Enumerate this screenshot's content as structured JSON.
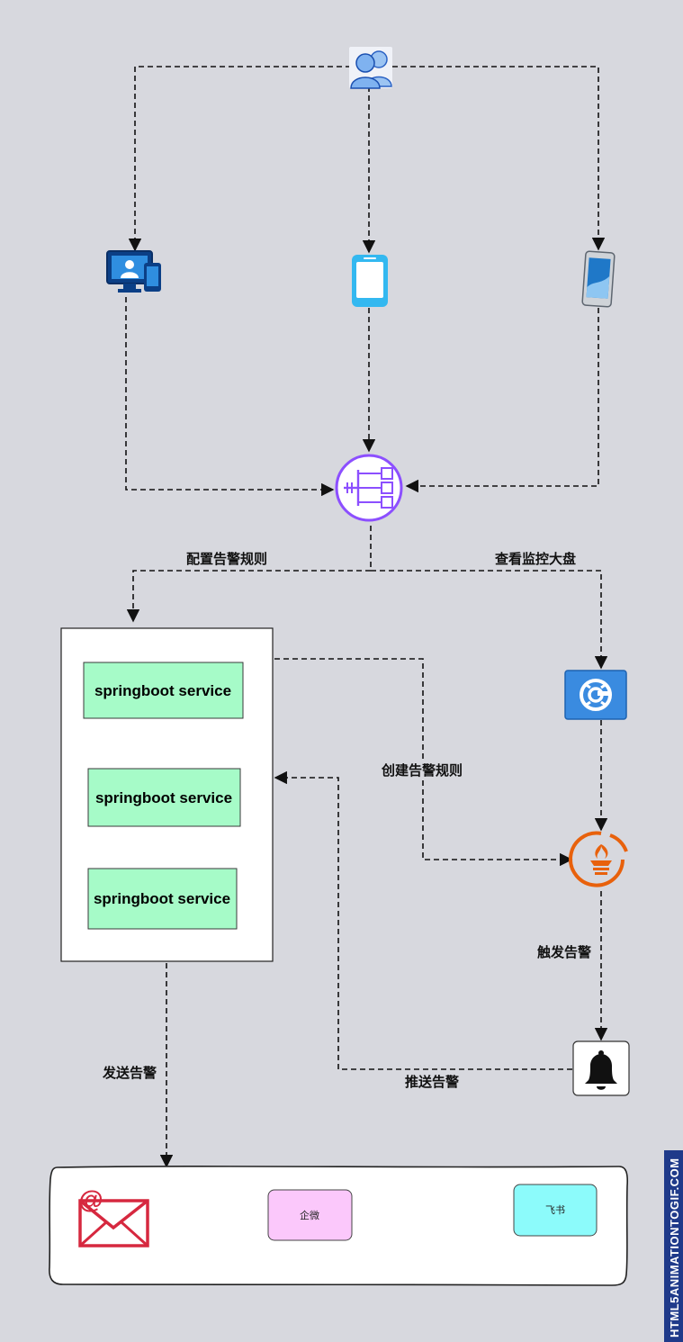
{
  "labels": {
    "config_rules": "配置告警规则",
    "view_dashboard": "查看监控大盘",
    "create_rules": "创建告警规则",
    "trigger_alert": "触发告警",
    "push_alert": "推送告警",
    "send_alert": "发送告警"
  },
  "services": [
    {
      "label": "springboot service"
    },
    {
      "label": "springboot service"
    },
    {
      "label": "springboot service"
    }
  ],
  "channels": {
    "wecom": "企微",
    "feishu": "飞书"
  },
  "icons": {
    "users": "users-icon",
    "desktop": "desktop-device-icon",
    "mobile": "mobile-phone-icon",
    "tablet": "tablet-icon",
    "gateway": "gateway-icon",
    "grafana": "grafana-icon",
    "prometheus": "prometheus-icon",
    "bell": "bell-icon",
    "email": "email-icon"
  },
  "colors": {
    "background": "#d7d8de",
    "service_fill": "#a6fbc8",
    "wecom_fill": "#fbc8fb",
    "feishu_fill": "#8cfbfb",
    "gateway": "#8c4fff",
    "grafana": "#3a8be0",
    "prometheus": "#e8610c",
    "email": "#d6283f"
  },
  "watermark": "HTML5ANIMATIONTOGIF.COM"
}
